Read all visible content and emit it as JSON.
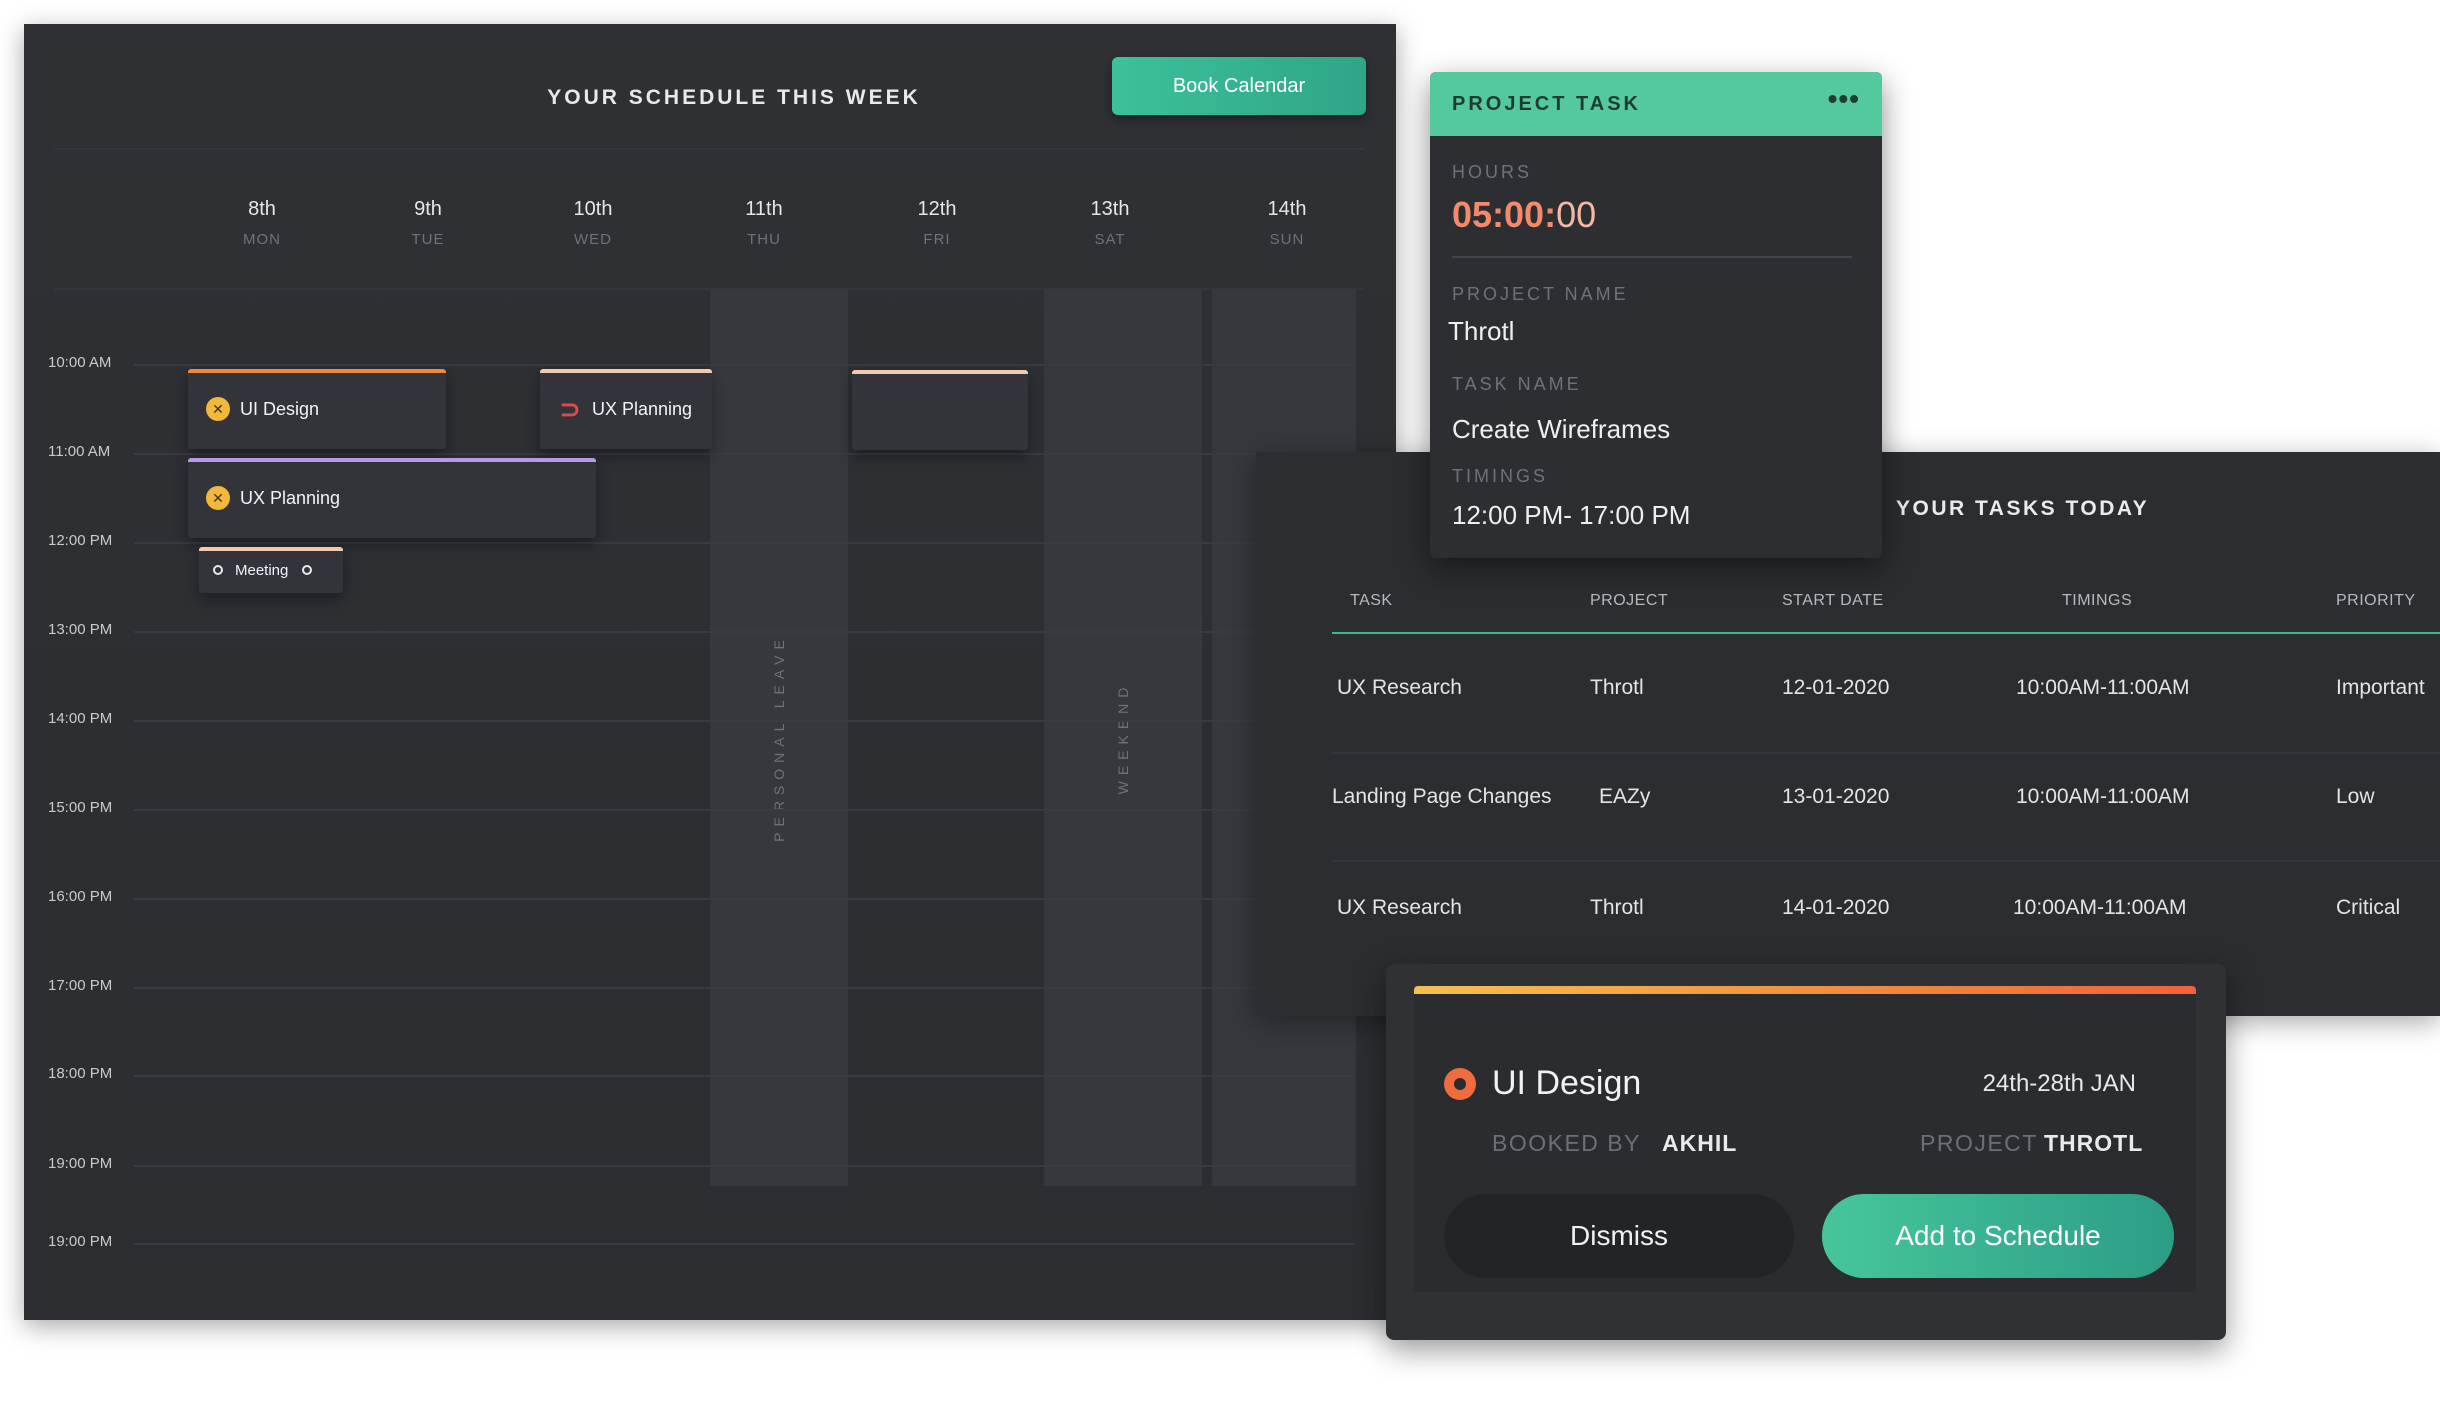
{
  "schedule": {
    "title": "YOUR SCHEDULE THIS WEEK",
    "book_button": "Book Calendar",
    "days": [
      {
        "num": "8th",
        "name": "MON"
      },
      {
        "num": "9th",
        "name": "TUE"
      },
      {
        "num": "10th",
        "name": "WED"
      },
      {
        "num": "11th",
        "name": "THU"
      },
      {
        "num": "12th",
        "name": "FRI"
      },
      {
        "num": "13th",
        "name": "SAT"
      },
      {
        "num": "14th",
        "name": "SUN"
      }
    ],
    "times": [
      "10:00 AM",
      "11:00 AM",
      "12:00 PM",
      "13:00 PM",
      "14:00 PM",
      "15:00 PM",
      "16:00 PM",
      "17:00 PM",
      "18:00 PM",
      "19:00 PM",
      "19:00 PM"
    ],
    "bands": {
      "personal_leave": "PERSONAL LEAVE",
      "weekend": "WEEKEND"
    },
    "events": {
      "ui_design": "UI Design",
      "ux_planning_wed": "UX Planning",
      "ux_planning_mon": "UX Planning",
      "meeting": "Meeting"
    },
    "colors": {
      "accent": "#3cc199",
      "orange": "#f0883e",
      "purple": "#b89be6",
      "peach": "#f5c8b0"
    }
  },
  "project_task": {
    "title": "PROJECT TASK",
    "menu_icon": "more-dots-icon",
    "hours_label": "HOURS",
    "hours_bold": "05:00:",
    "hours_light": "00",
    "project_name_label": "PROJECT NAME",
    "project_name": "Throtl",
    "task_name_label": "TASK NAME",
    "task_name": "Create Wireframes",
    "timings_label": "TIMINGS",
    "timings": "12:00 PM- 17:00 PM"
  },
  "tasks_today": {
    "title": "YOUR TASKS TODAY",
    "columns": [
      "TASK",
      "PROJECT",
      "START DATE",
      "TIMINGS",
      "PRIORITY"
    ],
    "rows": [
      {
        "task": "UX Research",
        "project": "Throtl",
        "start": "12-01-2020",
        "timings": "10:00AM-11:00AM",
        "priority": "Important"
      },
      {
        "task": "Landing Page Changes",
        "project": "EAZy",
        "start": "13-01-2020",
        "timings": "10:00AM-11:00AM",
        "priority": "Low"
      },
      {
        "task": "UX Research",
        "project": "Throtl",
        "start": "14-01-2020",
        "timings": "10:00AM-11:00AM",
        "priority": "Critical"
      }
    ]
  },
  "booking": {
    "title": "UI Design",
    "dates": "24th-28th JAN",
    "booked_by_label": "BOOKED BY",
    "booked_by": "AKHIL",
    "project_label": "PROJECT",
    "project": "THROTL",
    "dismiss": "Dismiss",
    "add": "Add to Schedule"
  }
}
